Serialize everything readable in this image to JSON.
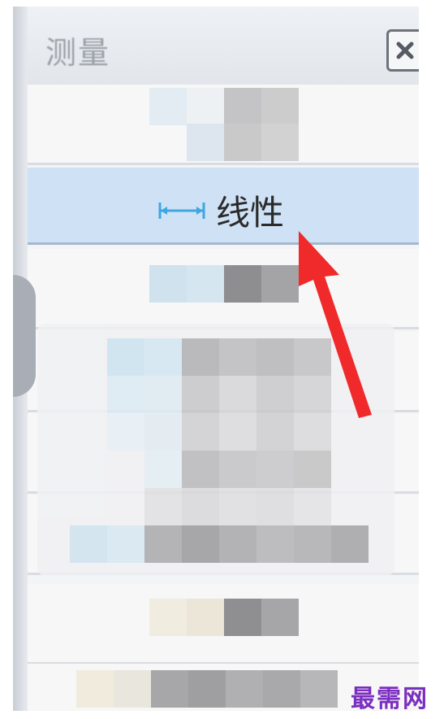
{
  "panel": {
    "title": "测量",
    "close_icon": "close-x-icon"
  },
  "selected_item": {
    "icon": "linear-dimension-icon",
    "label": "线性"
  },
  "annotation": {
    "color": "#f02a2a"
  },
  "watermark": {
    "text": "最需网"
  }
}
